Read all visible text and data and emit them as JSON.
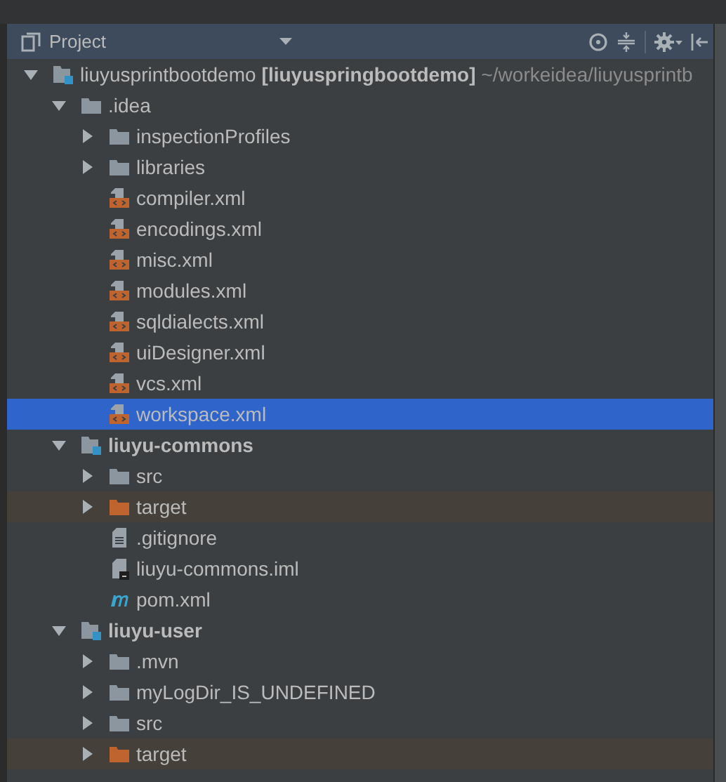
{
  "panel": {
    "title": "Project"
  },
  "tree": [
    {
      "name": "liuyusprintbootdemo",
      "module": "[liuyuspringbootdemo]",
      "path": "~/workeidea/liuyusprintb",
      "kind": "module",
      "expanded": true,
      "selected": false,
      "children": [
        {
          "name": ".idea",
          "kind": "folder",
          "expanded": true,
          "selected": false,
          "children": [
            {
              "name": "inspectionProfiles",
              "kind": "folder",
              "expanded": false,
              "selected": false
            },
            {
              "name": "libraries",
              "kind": "folder",
              "expanded": false,
              "selected": false
            },
            {
              "name": "compiler.xml",
              "kind": "xml",
              "selected": false
            },
            {
              "name": "encodings.xml",
              "kind": "xml",
              "selected": false
            },
            {
              "name": "misc.xml",
              "kind": "xml",
              "selected": false
            },
            {
              "name": "modules.xml",
              "kind": "xml",
              "selected": false
            },
            {
              "name": "sqldialects.xml",
              "kind": "xml",
              "selected": false
            },
            {
              "name": "uiDesigner.xml",
              "kind": "xml",
              "selected": false
            },
            {
              "name": "vcs.xml",
              "kind": "xml",
              "selected": false
            },
            {
              "name": "workspace.xml",
              "kind": "xml",
              "selected": true
            }
          ]
        },
        {
          "name": "liuyu-commons",
          "kind": "module",
          "expanded": true,
          "selected": false,
          "children": [
            {
              "name": "src",
              "kind": "folder",
              "expanded": false,
              "selected": false
            },
            {
              "name": "target",
              "kind": "excluded",
              "expanded": false,
              "selected": false
            },
            {
              "name": ".gitignore",
              "kind": "text",
              "selected": false
            },
            {
              "name": "liuyu-commons.iml",
              "kind": "iml",
              "selected": false
            },
            {
              "name": "pom.xml",
              "kind": "maven",
              "selected": false
            }
          ]
        },
        {
          "name": "liuyu-user",
          "kind": "module",
          "expanded": true,
          "selected": false,
          "children": [
            {
              "name": ".mvn",
              "kind": "folder",
              "expanded": false,
              "selected": false
            },
            {
              "name": "myLogDir_IS_UNDEFINED",
              "kind": "folder",
              "expanded": false,
              "selected": false
            },
            {
              "name": "src",
              "kind": "folder",
              "expanded": false,
              "selected": false
            },
            {
              "name": "target",
              "kind": "excluded",
              "expanded": false,
              "selected": false
            }
          ]
        }
      ]
    }
  ]
}
